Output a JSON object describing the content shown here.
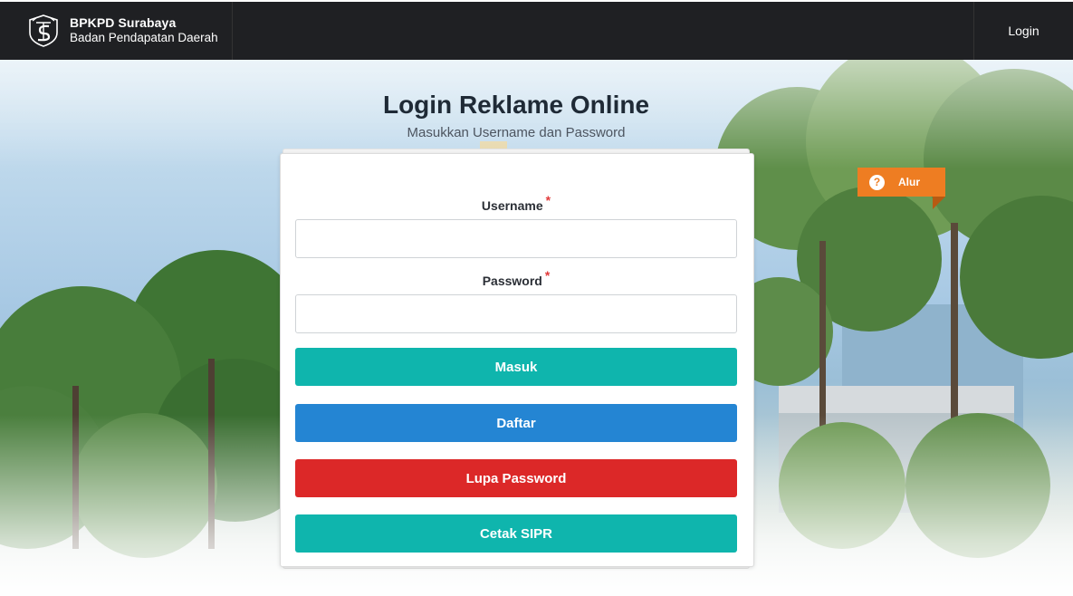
{
  "navbar": {
    "brand_title": "BPKPD Surabaya",
    "brand_subtitle": "Badan Pendapatan Daerah",
    "login_label": "Login",
    "logo_icon": "surabaya-emblem-icon"
  },
  "page": {
    "title": "Login Reklame Online",
    "subtitle": "Masukkan Username dan Password"
  },
  "form": {
    "username_label": "Username",
    "password_label": "Password",
    "required_mark": "*",
    "username_value": "",
    "password_value": "",
    "buttons": [
      {
        "label": "Masuk",
        "color": "#0fb5ad"
      },
      {
        "label": "Daftar",
        "color": "#2485d3"
      },
      {
        "label": "Lupa Password",
        "color": "#dc2828"
      },
      {
        "label": "Cetak SIPR",
        "color": "#0fb5ad"
      }
    ]
  },
  "alur": {
    "label": "Alur",
    "icon": "question-circle-icon",
    "color": "#ee7d22"
  }
}
